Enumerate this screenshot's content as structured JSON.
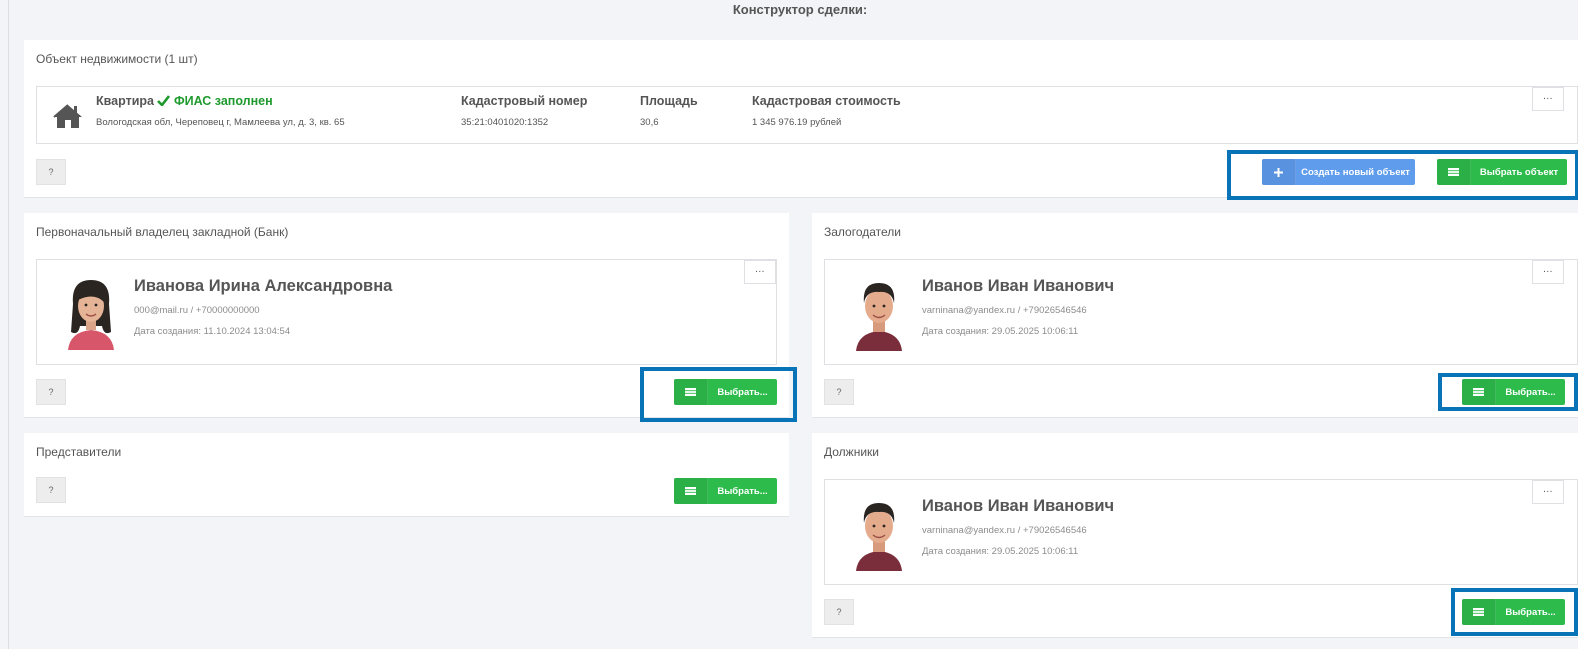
{
  "page": {
    "title": "Конструктор сделки:"
  },
  "property_panel": {
    "title": "Объект недвижимости (1 шт)",
    "item": {
      "icon": "house-icon",
      "type": "Квартира",
      "fias_status": "ФИАС заполнен",
      "address": "Вологодская обл, Череповец г, Мамлеева ул, д. 3, кв. 65",
      "columns": [
        {
          "header": "Кадастровый номер",
          "value": "35:21:0401020:1352"
        },
        {
          "header": "Площадь",
          "value": "30,6"
        },
        {
          "header": "Кадастровая стоимость",
          "value": "1 345 976.19 рублей"
        }
      ]
    },
    "menu_label": "...",
    "help_label": "?",
    "create_button": "Создать новый объект",
    "select_button": "Выбрать объект"
  },
  "bank_panel": {
    "title": "Первоначальный владелец закладной (Банк)",
    "person": {
      "name": "Иванова Ирина Александровна",
      "contact": "000@mail.ru / +70000000000",
      "created": "Дата создания: 11.10.2024 13:04:54"
    },
    "menu_label": "...",
    "help_label": "?",
    "select_button": "Выбрать..."
  },
  "pledgers_panel": {
    "title": "Залогодатели",
    "person": {
      "name": "Иванов Иван Иванович",
      "contact": "varninana@yandex.ru / +79026546546",
      "created": "Дата создания: 29.05.2025 10:06:11"
    },
    "menu_label": "...",
    "help_label": "?",
    "select_button": "Выбрать..."
  },
  "representatives_panel": {
    "title": "Представители",
    "help_label": "?",
    "select_button": "Выбрать..."
  },
  "debtors_panel": {
    "title": "Должники",
    "person": {
      "name": "Иванов Иван Иванович",
      "contact": "varninana@yandex.ru / +79026546546",
      "created": "Дата создания: 29.05.2025 10:06:11"
    },
    "menu_label": "...",
    "help_label": "?",
    "select_button": "Выбрать..."
  },
  "colors": {
    "green": "#2dbb4c",
    "blue": "#5f9cec",
    "highlight": "#0973b8",
    "fias_green": "#1f9a2e"
  }
}
